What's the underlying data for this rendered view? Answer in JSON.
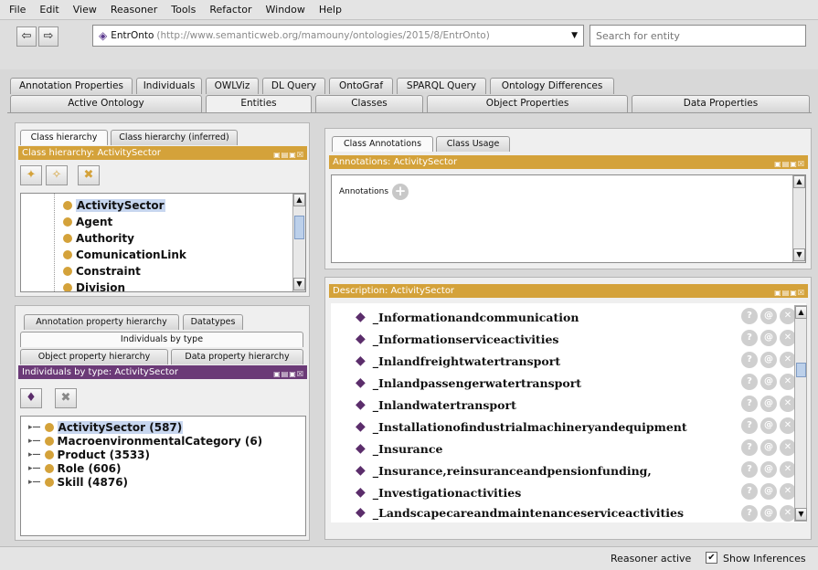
{
  "menu": [
    "File",
    "Edit",
    "View",
    "Reasoner",
    "Tools",
    "Refactor",
    "Window",
    "Help"
  ],
  "toolbar": {
    "back_icon": "arrow-left",
    "forward_icon": "arrow-right",
    "ontology_name": "EntrOnto",
    "ontology_iri": "(http://www.semanticweb.org/mamouny/ontologies/2015/8/EntrOnto)",
    "search_placeholder": "Search for entity"
  },
  "tabs_row1": [
    "Annotation Properties",
    "Individuals",
    "OWLViz",
    "DL Query",
    "OntoGraf",
    "SPARQL Query",
    "Ontology Differences"
  ],
  "tabs_row2": [
    "Active Ontology",
    "Entities",
    "Classes",
    "Object Properties",
    "Data Properties"
  ],
  "selected_tab": "Entities",
  "class_panel": {
    "tabs": [
      "Class hierarchy",
      "Class hierarchy (inferred)"
    ],
    "header": "Class hierarchy: ActivitySector",
    "items": [
      "ActivitySector",
      "Agent",
      "Authority",
      "ComunicationLink",
      "Constraint",
      "Division"
    ]
  },
  "individuals_panel": {
    "tabs_r1": [
      "Annotation property hierarchy",
      "Datatypes"
    ],
    "tabs_r2": [
      "Individuals by type"
    ],
    "tabs_r3": [
      "Object property hierarchy",
      "Data property hierarchy"
    ],
    "header": "Individuals by type: ActivitySector",
    "items": [
      "ActivitySector (587)",
      "MacroenvironmentalCategory (6)",
      "Product (3533)",
      "Role (606)",
      "Skill (4876)"
    ]
  },
  "annotations_panel": {
    "tabs": [
      "Class Annotations",
      "Class Usage"
    ],
    "header": "Annotations: ActivitySector",
    "label": "Annotations"
  },
  "description_panel": {
    "header": "Description: ActivitySector",
    "items": [
      "_Informationandcommunication",
      "_Informationserviceactivities",
      "_Inlandfreightwatertransport",
      "_Inlandpassengerwatertransport",
      "_Inlandwatertransport",
      "_Installationofindustrialmachineryandequipment",
      "_Insurance",
      "_Insurance,reinsuranceandpensionfunding,",
      "_Investigationactivities",
      "_Landscapecareandmaintenanceserviceactivities"
    ]
  },
  "status": {
    "reasoner": "Reasoner active",
    "show_inferences": "Show Inferences",
    "show_inferences_checked": true
  }
}
